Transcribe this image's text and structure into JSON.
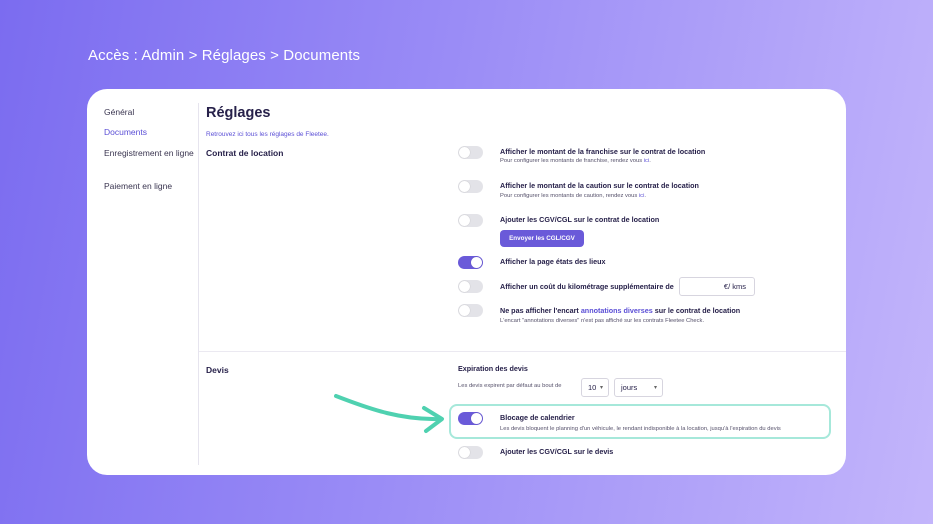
{
  "breadcrumb": "Accès : Admin > Réglages > Documents",
  "sidebar": {
    "items": [
      {
        "label": "Général"
      },
      {
        "label": "Documents"
      },
      {
        "label": "Enregistrement en ligne"
      },
      {
        "label": "Paiement en ligne"
      }
    ]
  },
  "main": {
    "title": "Réglages",
    "subtitle": "Retrouvez ici tous les réglages de Fleetee.",
    "sections": {
      "contrat": "Contrat de location",
      "devis": "Devis"
    },
    "options": {
      "franchise": {
        "title": "Afficher le montant de la franchise sur le contrat de location",
        "desc_prefix": "Pour configurer les montants de franchise, rendez vous ",
        "desc_link": "ici",
        "desc_suffix": "."
      },
      "caution": {
        "title": "Afficher le montant de la caution sur le contrat de location",
        "desc_prefix": "Pour configurer les montants de caution, rendez vous ",
        "desc_link": "ici",
        "desc_suffix": "."
      },
      "cgv": {
        "title": "Ajouter les CGV/CGL sur le contrat de location",
        "button": "Envoyer les CGL/CGV"
      },
      "etats": {
        "title": "Afficher la page états des lieux"
      },
      "km": {
        "title": "Afficher un coût du kilométrage supplémentaire de",
        "input_value": "€/ kms"
      },
      "annotations": {
        "title_prefix": "Ne pas afficher l'encart ",
        "title_link": "annotations diverses",
        "title_suffix": " sur le contrat de location",
        "desc": "L'encart \"annotations diverses\" n'est pas affiché sur les contrats Fleetee Check."
      },
      "expiration": {
        "title": "Expiration des devis",
        "desc": "Les devis expirent par défaut au bout de",
        "number_value": "10",
        "unit_value": "jours"
      },
      "blocage": {
        "title": "Blocage de calendrier",
        "desc": "Les devis bloquent le planning d'un véhicule, le rendant indisponible à la location, jusqu'à l'expiration du devis"
      },
      "cgv_devis": {
        "title": "Ajouter les CGV/CGL sur le devis"
      }
    }
  },
  "colors": {
    "accent": "#6a5ad9",
    "highlight": "#a6e8da",
    "arrow": "#4fd1b0"
  }
}
